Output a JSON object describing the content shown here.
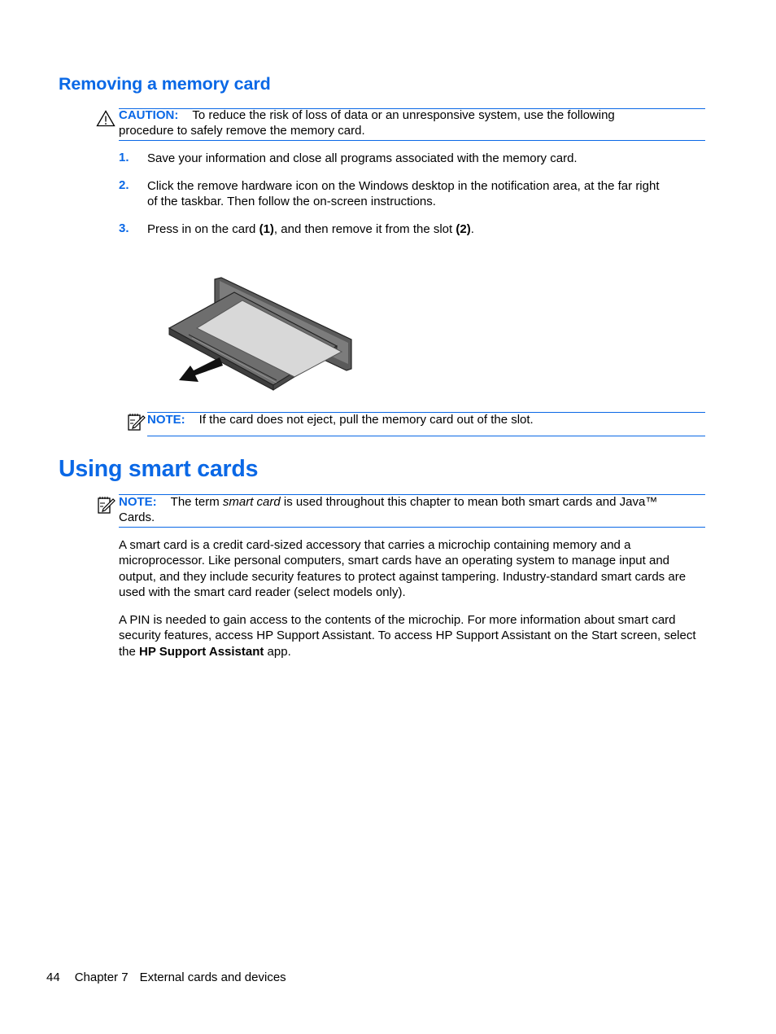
{
  "section1": {
    "title": "Removing a memory card",
    "caution": {
      "label": "CAUTION:",
      "text_line1": "To reduce the risk of loss of data or an unresponsive system, use the following",
      "text_line2": "procedure to safely remove the memory card."
    },
    "steps": [
      {
        "num": "1.",
        "text": "Save your information and close all programs associated with the memory card."
      },
      {
        "num": "2.",
        "text_line1": "Click the remove hardware icon on the Windows desktop in the notification area, at the far right",
        "text_line2": "of the taskbar. Then follow the on-screen instructions."
      },
      {
        "num": "3.",
        "pre": "Press in on the card ",
        "b1": "(1)",
        "mid": ", and then remove it from the slot ",
        "b2": "(2)",
        "post": "."
      }
    ],
    "figure": {
      "alt": "memory-card-being-removed-from-slot"
    },
    "note": {
      "label": "NOTE:",
      "text": "If the card does not eject, pull the memory card out of the slot."
    }
  },
  "section2": {
    "title": "Using smart cards",
    "note": {
      "label": "NOTE:",
      "pre": "The term ",
      "em": "smart card",
      "post": " is used throughout this chapter to mean both smart cards and Java™",
      "line2": "Cards."
    },
    "para1": "A smart card is a credit card-sized accessory that carries a microchip containing memory and a microprocessor. Like personal computers, smart cards have an operating system to manage input and output, and they include security features to protect against tampering. Industry-standard smart cards are used with the smart card reader (select models only).",
    "para2": {
      "pre": "A PIN is needed to gain access to the contents of the microchip. For more information about smart card security features, access HP Support Assistant. To access HP Support Assistant on the Start screen, select the ",
      "bold": "HP Support Assistant",
      "post": " app."
    }
  },
  "footer": {
    "page_number": "44",
    "chapter": "Chapter 7",
    "chapter_title": "External cards and devices"
  },
  "colors": {
    "accent": "#0a68e6"
  }
}
